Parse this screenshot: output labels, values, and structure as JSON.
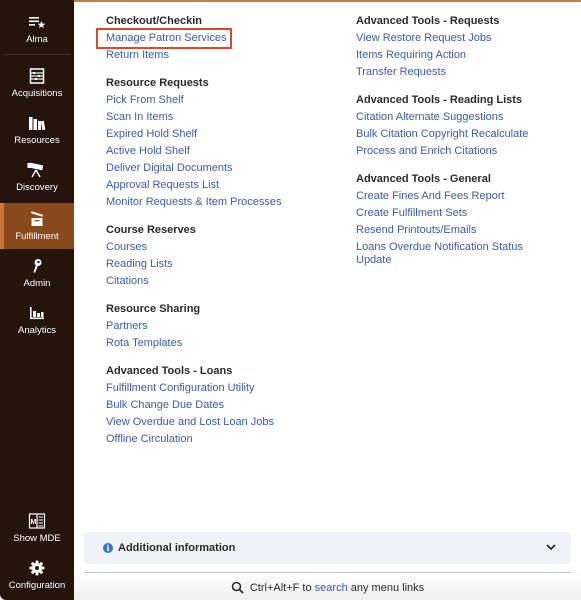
{
  "sidebar": {
    "items": [
      {
        "label": "Alma",
        "icon": "alma-star-list-icon"
      },
      {
        "label": "Acquisitions",
        "icon": "abacus-icon"
      },
      {
        "label": "Resources",
        "icon": "books-icon"
      },
      {
        "label": "Discovery",
        "icon": "telescope-icon"
      },
      {
        "label": "Fulfillment",
        "icon": "box-icon",
        "active": true
      },
      {
        "label": "Admin",
        "icon": "key-icon"
      },
      {
        "label": "Analytics",
        "icon": "bar-chart-icon"
      },
      {
        "label": "Show MDE",
        "icon": "mde-book-icon"
      },
      {
        "label": "Configuration",
        "icon": "gear-icon"
      }
    ]
  },
  "menu": {
    "left": [
      {
        "title": "Checkout/Checkin",
        "links": [
          "Manage Patron Services",
          "Return Items"
        ]
      },
      {
        "title": "Resource Requests",
        "links": [
          "Pick From Shelf",
          "Scan In Items",
          "Expired Hold Shelf",
          "Active Hold Shelf",
          "Deliver Digital Documents",
          "Approval Requests List",
          "Monitor Requests & Item Processes"
        ]
      },
      {
        "title": "Course Reserves",
        "links": [
          "Courses",
          "Reading Lists",
          "Citations"
        ]
      },
      {
        "title": "Resource Sharing",
        "links": [
          "Partners",
          "Rota Templates"
        ]
      },
      {
        "title": "Advanced Tools - Loans",
        "links": [
          "Fulfillment Configuration Utility",
          "Bulk Change Due Dates",
          "View Overdue and Lost Loan Jobs",
          "Offline Circulation"
        ]
      }
    ],
    "right": [
      {
        "title": "Advanced Tools - Requests",
        "links": [
          "View Restore Request Jobs",
          "Items Requiring Action",
          "Transfer Requests"
        ]
      },
      {
        "title": "Advanced Tools - Reading Lists",
        "links": [
          "Citation Alternate Suggestions",
          "Bulk Citation Copyright Recalculate",
          "Process and Enrich Citations"
        ]
      },
      {
        "title": "Advanced Tools - General",
        "links": [
          "Create Fines And Fees Report",
          "Create Fulfillment Sets",
          "Resend Printouts/Emails",
          "Loans Overdue Notification Status Update"
        ]
      }
    ],
    "highlighted_link": "Manage Patron Services"
  },
  "info": {
    "title": "Additional information",
    "icon": "info-icon"
  },
  "footer": {
    "shortcut": "Ctrl+Alt+F",
    "to": "to",
    "keyword": "search",
    "rest": "any menu links"
  },
  "colors": {
    "sidebar_bg": "#24140c",
    "active_bg": "#8a4a1e",
    "link": "#3a5ba6",
    "highlight_border": "#e0462c"
  }
}
